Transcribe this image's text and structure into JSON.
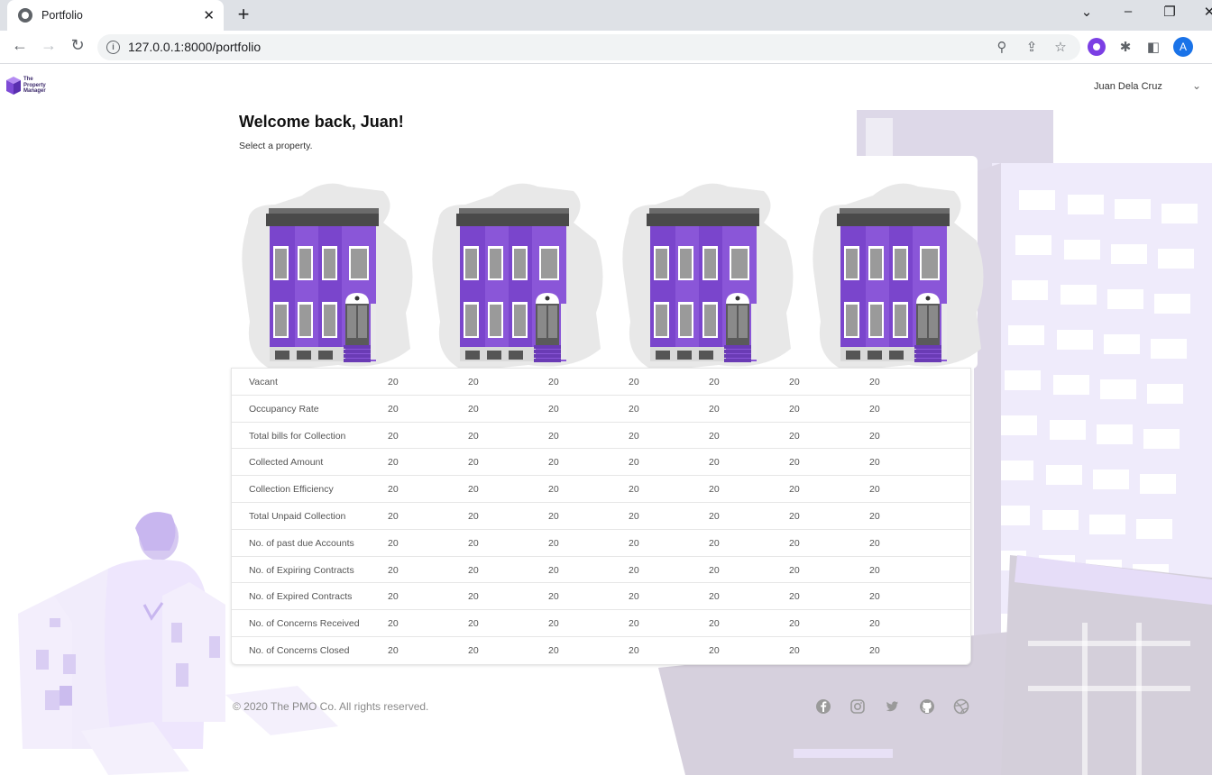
{
  "browser": {
    "tab_title": "Portfolio",
    "url": "127.0.0.1:8000/portfolio",
    "profile_initial": "A"
  },
  "header": {
    "logo_line1": "The",
    "logo_line2": "Property",
    "logo_line3": "Manager",
    "user_name": "Juan Dela Cruz"
  },
  "main": {
    "welcome": "Welcome back, Juan!",
    "subtitle": "Select a property.",
    "property_count": 4
  },
  "table": {
    "rows": [
      {
        "label": "Vacant",
        "values": [
          "20",
          "20",
          "20",
          "20",
          "20",
          "20",
          "20"
        ]
      },
      {
        "label": "Occupancy Rate",
        "values": [
          "20",
          "20",
          "20",
          "20",
          "20",
          "20",
          "20"
        ]
      },
      {
        "label": "Total bills for Collection",
        "values": [
          "20",
          "20",
          "20",
          "20",
          "20",
          "20",
          "20"
        ]
      },
      {
        "label": "Collected Amount",
        "values": [
          "20",
          "20",
          "20",
          "20",
          "20",
          "20",
          "20"
        ]
      },
      {
        "label": "Collection Efficiency",
        "values": [
          "20",
          "20",
          "20",
          "20",
          "20",
          "20",
          "20"
        ]
      },
      {
        "label": "Total Unpaid Collection",
        "values": [
          "20",
          "20",
          "20",
          "20",
          "20",
          "20",
          "20"
        ]
      },
      {
        "label": "No. of past due Accounts",
        "values": [
          "20",
          "20",
          "20",
          "20",
          "20",
          "20",
          "20"
        ]
      },
      {
        "label": "No. of Expiring Contracts",
        "values": [
          "20",
          "20",
          "20",
          "20",
          "20",
          "20",
          "20"
        ]
      },
      {
        "label": "No. of Expired Contracts",
        "values": [
          "20",
          "20",
          "20",
          "20",
          "20",
          "20",
          "20"
        ]
      },
      {
        "label": "No. of Concerns Received",
        "values": [
          "20",
          "20",
          "20",
          "20",
          "20",
          "20",
          "20"
        ]
      },
      {
        "label": "No. of Concerns Closed",
        "values": [
          "20",
          "20",
          "20",
          "20",
          "20",
          "20",
          "20"
        ]
      }
    ]
  },
  "footer": {
    "copyright": "© 2020 The PMO Co. All rights reserved.",
    "social_icons": [
      "facebook-icon",
      "instagram-icon",
      "twitter-icon",
      "github-icon",
      "dribbble-icon"
    ]
  },
  "colors": {
    "brand_purple": "#7e4bd6",
    "building_purple": "#8a56d8",
    "building_dark": "#4a4a4a",
    "bg_illustration": "#ece6f9"
  }
}
